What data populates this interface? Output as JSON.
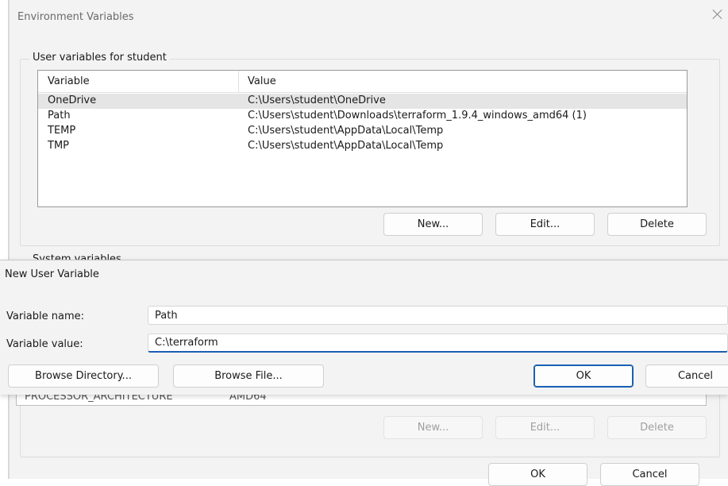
{
  "env_dialog": {
    "title": "Environment Variables",
    "user_group_label": "User variables for student",
    "columns": {
      "variable": "Variable",
      "value": "Value"
    },
    "user_rows": [
      {
        "variable": "OneDrive",
        "value": "C:\\Users\\student\\OneDrive"
      },
      {
        "variable": "Path",
        "value": "C:\\Users\\student\\Downloads\\terraform_1.9.4_windows_amd64 (1)"
      },
      {
        "variable": "TEMP",
        "value": "C:\\Users\\student\\AppData\\Local\\Temp"
      },
      {
        "variable": "TMP",
        "value": "C:\\Users\\student\\AppData\\Local\\Temp"
      }
    ],
    "user_buttons": {
      "new": "New...",
      "edit": "Edit...",
      "delete": "Delete"
    },
    "system_group_label": "System variables",
    "system_row": {
      "variable": "PROCESSOR_ARCHITECTURE",
      "value": "AMD64"
    },
    "system_buttons": {
      "new": "New...",
      "edit": "Edit...",
      "delete": "Delete"
    },
    "footer_buttons": {
      "ok": "OK",
      "cancel": "Cancel"
    },
    "close_icon": "close-icon"
  },
  "new_var_dialog": {
    "title": "New User Variable",
    "name_label": "Variable name:",
    "name_value": "Path",
    "value_label": "Variable value:",
    "value_value": "C:\\terraform",
    "buttons": {
      "browse_directory": "Browse Directory...",
      "browse_file": "Browse File...",
      "ok": "OK",
      "cancel": "Cancel"
    }
  },
  "colors": {
    "accent": "#1a5fb4",
    "selected_row": "#e5e5e5",
    "dialog_bg": "#f3f3f3"
  }
}
